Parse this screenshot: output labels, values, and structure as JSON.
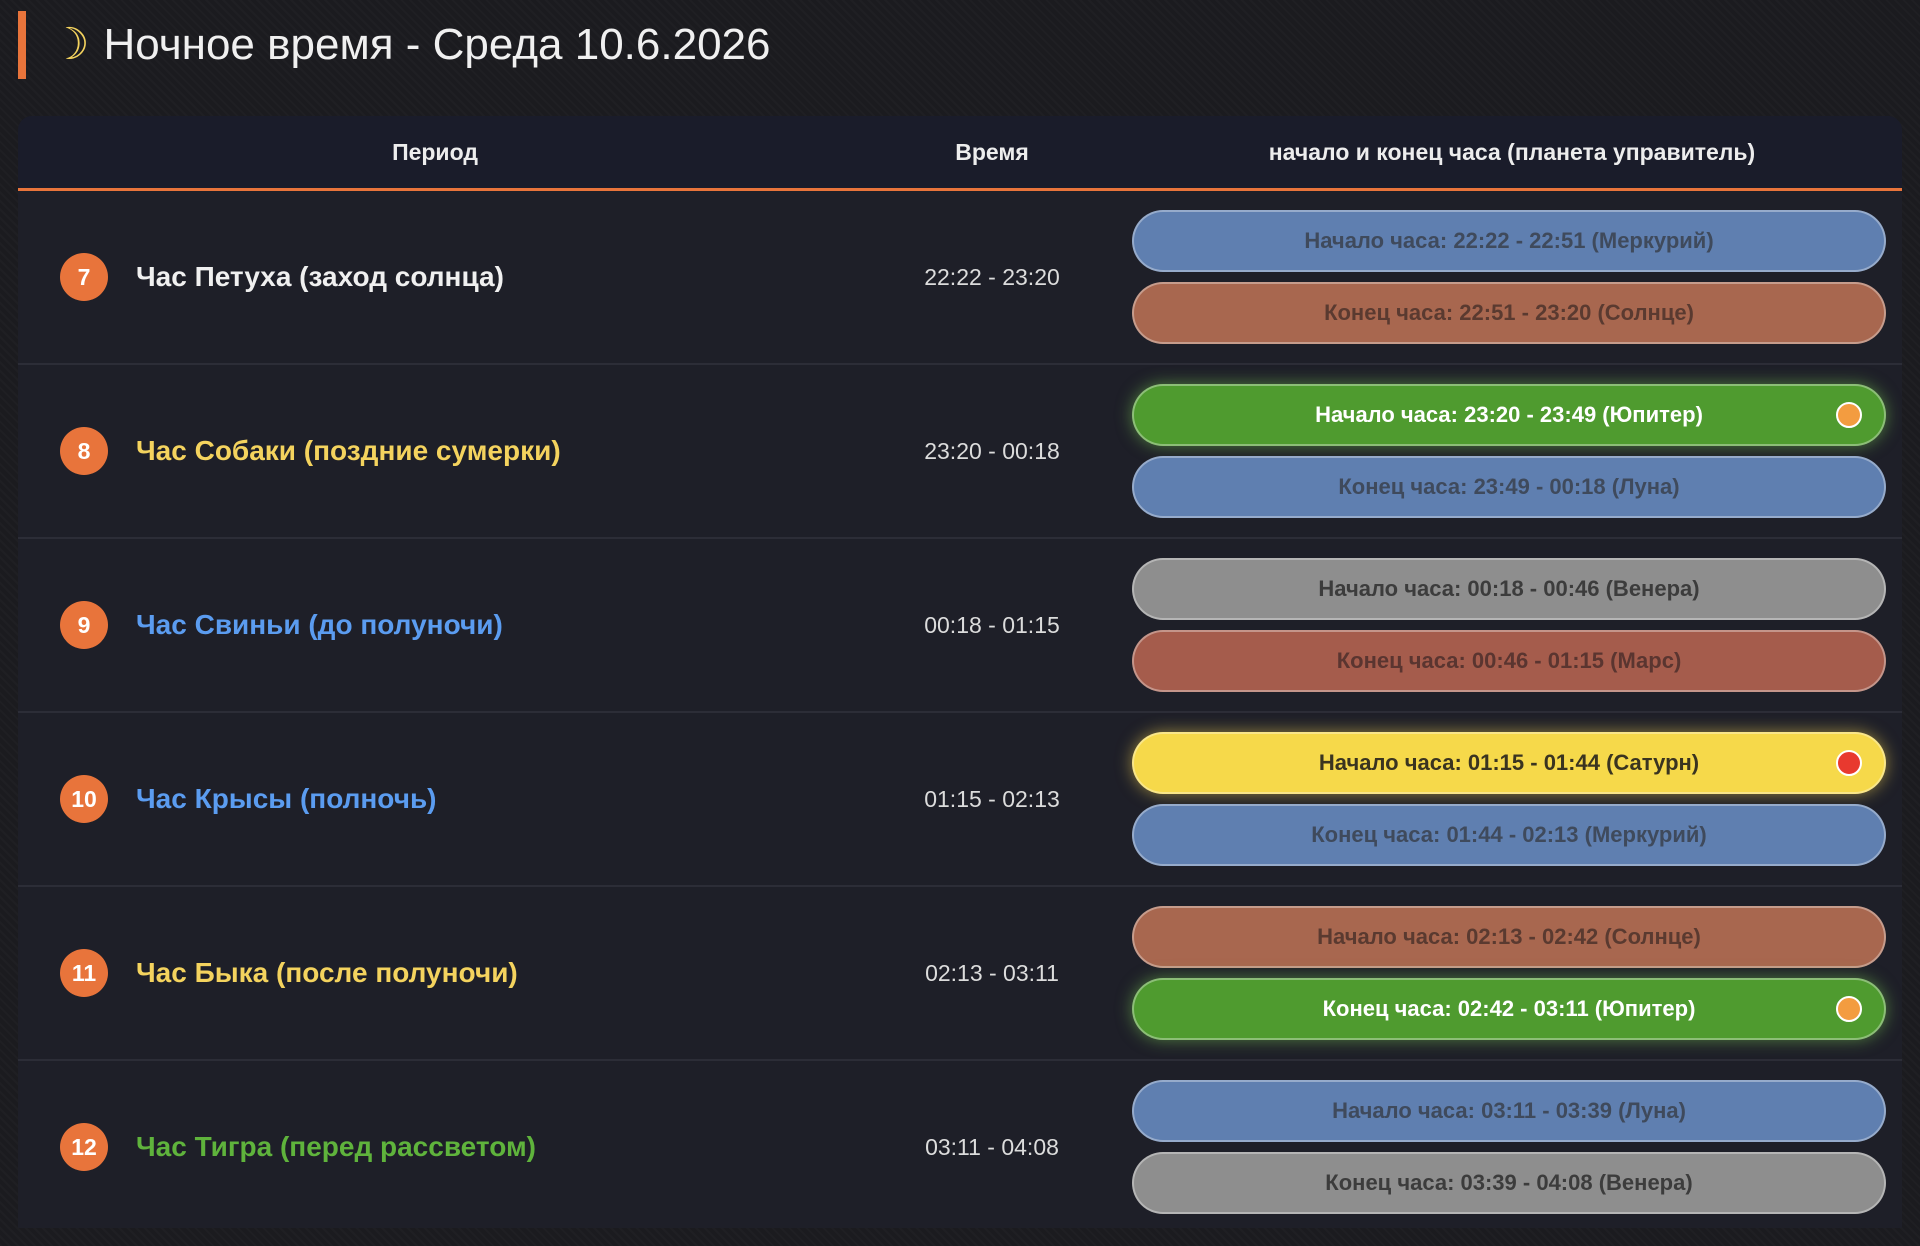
{
  "header": {
    "icon": "moon-icon",
    "title": "Ночное время - Среда 10.6.2026"
  },
  "table": {
    "headers": {
      "period": "Период",
      "time": "Время",
      "hours": "начало и конец часа (планета управитель)"
    },
    "rows": [
      {
        "num": "7",
        "name": "Час Петуха (заход солнца)",
        "name_color": "#f0f0f0",
        "time": "22:22 - 23:20",
        "hours": [
          {
            "label": "Начало часа: 22:22 - 22:51 (Меркурий)",
            "bg": "#5f7fb0",
            "fg": "#3f4a5c",
            "active": false,
            "dot": ""
          },
          {
            "label": "Конец часа: 22:51 - 23:20 (Солнце)",
            "bg": "#a8674f",
            "fg": "#5a3a30",
            "active": false,
            "dot": ""
          }
        ]
      },
      {
        "num": "8",
        "name": "Час Собаки (поздние сумерки)",
        "name_color": "#f4d35e",
        "time": "23:20 - 00:18",
        "hours": [
          {
            "label": "Начало часа: 23:20 - 23:49 (Юпитер)",
            "bg": "#4f9b2f",
            "fg": "#ffffff",
            "active": true,
            "dot": "#f39c40"
          },
          {
            "label": "Конец часа: 23:49 - 00:18 (Луна)",
            "bg": "#5f7fb0",
            "fg": "#3f4a5c",
            "active": false,
            "dot": ""
          }
        ]
      },
      {
        "num": "9",
        "name": "Час Свиньи (до полуночи)",
        "name_color": "#5b9cf0",
        "time": "00:18 - 01:15",
        "hours": [
          {
            "label": "Начало часа: 00:18 - 00:46 (Венера)",
            "bg": "#8e8e8e",
            "fg": "#3c3c3c",
            "active": false,
            "dot": ""
          },
          {
            "label": "Конец часа: 00:46 - 01:15 (Марс)",
            "bg": "#a55c4c",
            "fg": "#5a3530",
            "active": false,
            "dot": ""
          }
        ]
      },
      {
        "num": "10",
        "name": "Час Крысы (полночь)",
        "name_color": "#5b9cf0",
        "time": "01:15 - 02:13",
        "hours": [
          {
            "label": "Начало часа: 01:15 - 01:44 (Сатурн)",
            "bg": "#f6d94a",
            "fg": "#3a3420",
            "active": true,
            "dot": "#e8392f"
          },
          {
            "label": "Конец часа: 01:44 - 02:13 (Меркурий)",
            "bg": "#5f7fb0",
            "fg": "#3f4a5c",
            "active": false,
            "dot": ""
          }
        ]
      },
      {
        "num": "11",
        "name": "Час Быка (после полуночи)",
        "name_color": "#f4d35e",
        "time": "02:13 - 03:11",
        "hours": [
          {
            "label": "Начало часа: 02:13 - 02:42 (Солнце)",
            "bg": "#a8674f",
            "fg": "#5a3a30",
            "active": false,
            "dot": ""
          },
          {
            "label": "Конец часа: 02:42 - 03:11 (Юпитер)",
            "bg": "#4f9b2f",
            "fg": "#ffffff",
            "active": true,
            "dot": "#f39c40"
          }
        ]
      },
      {
        "num": "12",
        "name": "Час Тигра (перед рассветом)",
        "name_color": "#5fb33c",
        "time": "03:11 - 04:08",
        "hours": [
          {
            "label": "Начало часа: 03:11 - 03:39 (Луна)",
            "bg": "#5f7fb0",
            "fg": "#3f4a5c",
            "active": false,
            "dot": ""
          },
          {
            "label": "Конец часа: 03:39 - 04:08 (Венера)",
            "bg": "#8e8e8e",
            "fg": "#3c3c3c",
            "active": false,
            "dot": ""
          }
        ]
      }
    ]
  }
}
